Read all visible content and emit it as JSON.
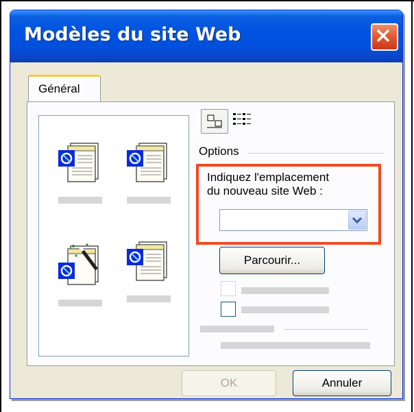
{
  "window": {
    "title": "Modèles du site Web",
    "close_icon": "close-x-icon"
  },
  "tabs": [
    {
      "label": "Général",
      "active": true
    }
  ],
  "templates": [
    {
      "icon": "web-page-template-icon"
    },
    {
      "icon": "web-page-template-icon"
    },
    {
      "icon": "web-wizard-template-icon"
    },
    {
      "icon": "web-page-template-icon"
    }
  ],
  "view_buttons": [
    {
      "icon": "large-icons-view-icon",
      "selected": true
    },
    {
      "icon": "details-view-icon",
      "selected": false
    }
  ],
  "options": {
    "label": "Options",
    "location_prompt_line1": "Indiquez l'emplacement",
    "location_prompt_line2": "du nouveau site Web :",
    "location_value": "",
    "browse_label": "Parcourir..."
  },
  "buttons": {
    "ok_label": "OK",
    "ok_enabled": false,
    "cancel_label": "Annuler"
  },
  "colors": {
    "highlight": "#f04a22",
    "titlebar": "#0053e1"
  }
}
